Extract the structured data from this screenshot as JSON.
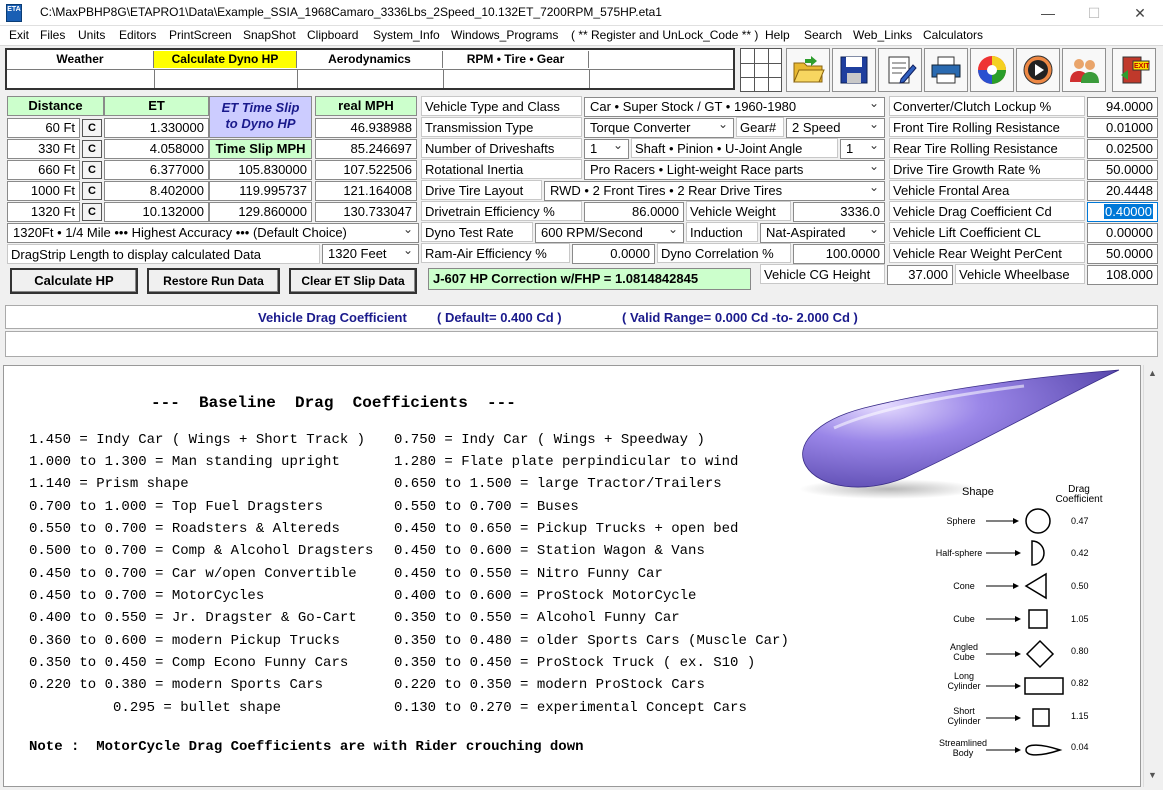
{
  "window": {
    "title": "C:\\MaxPBHP8G\\ETAPRO1\\Data\\Example_SSIA_1968Camaro_3336Lbs_2Speed_10.132ET_7200RPM_575HP.eta1",
    "icon_text": "ETA",
    "minimize": "—",
    "maximize": "☐",
    "close": "✕"
  },
  "menu": [
    "Exit",
    "Files",
    "Units",
    "Editors",
    "PrintScreen",
    "SnapShot",
    "Clipboard",
    "System_Info",
    "Windows_Programs",
    "( ** Register and UnLock_Code ** )",
    "Help",
    "Search",
    "Web_Links",
    "Calculators"
  ],
  "tabs": [
    "Weather",
    "Calculate Dyno HP",
    "Aerodynamics",
    "RPM  •  Tire  •  Gear"
  ],
  "toolbar": [
    "open-folder-icon",
    "save-disk-icon",
    "edit-notepad-icon",
    "printer-icon",
    "color-wheel-icon",
    "play-icon",
    "users-icon",
    "exit-door-icon"
  ],
  "colors": {
    "yellow_tab": "#ffff00",
    "green_header": "#ccffcc",
    "title_blue": "#1a1a8c",
    "selection": "#0078d7"
  },
  "runs": {
    "headers": {
      "distance": "Distance",
      "et": "ET",
      "et_slip": "ET Time Slip to Dyno HP",
      "time_slip_mph": "Time Slip MPH",
      "real_mph": "real  MPH"
    },
    "clear_label": "C",
    "rows": [
      {
        "dist": "60 Ft",
        "et": "1.330000",
        "slip_mph": "",
        "real_mph": "46.938988"
      },
      {
        "dist": "330 Ft",
        "et": "4.058000",
        "slip_mph": "",
        "real_mph": "85.246697"
      },
      {
        "dist": "660 Ft",
        "et": "6.377000",
        "slip_mph": "105.830000",
        "real_mph": "107.522506"
      },
      {
        "dist": "1000 Ft",
        "et": "8.402000",
        "slip_mph": "119.995737",
        "real_mph": "121.164008"
      },
      {
        "dist": "1320 Ft",
        "et": "10.132000",
        "slip_mph": "129.860000",
        "real_mph": "130.733047"
      }
    ],
    "accuracy": "1320Ft • 1/4 Mile ••• Highest Accuracy ••• (Default Choice)",
    "dragstrip_label": "DragStrip Length to display calculated Data",
    "dragstrip_value": "1320 Feet",
    "calc_btn": "Calculate  HP",
    "restore_btn": "Restore Run Data",
    "clear_btn": "Clear ET Slip Data",
    "correction": "J-607 HP Correction w/FHP = 1.0814842845"
  },
  "vehicle": {
    "type_label": "Vehicle Type and Class",
    "type_value": "Car  •  Super Stock / GT  •  1960-1980",
    "trans_label": "Transmission Type",
    "trans_value": "Torque Converter",
    "gear_label": "Gear#",
    "gear_value": "2  Speed",
    "shafts_label": "Number of Driveshafts",
    "shafts_value": "1",
    "ujoint_label": "Shaft • Pinion • U-Joint Angle",
    "ujoint_value": "1",
    "inertia_label": "Rotational Inertia",
    "inertia_value": "Pro Racers  •  Light-weight Race parts",
    "layout_label": "Drive Tire Layout",
    "layout_value": "RWD • 2  Front Tires  •  2  Rear Drive Tires",
    "eff_label": "Drivetrain Efficiency %",
    "eff_value": "86.0000",
    "weight_label": "Vehicle Weight",
    "weight_value": "3336.0",
    "dyno_label": "Dyno Test Rate",
    "dyno_value": "600 RPM/Second",
    "induction_label": "Induction",
    "induction_value": "Nat-Aspirated",
    "ram_label": "Ram-Air Efficiency %",
    "ram_value": "0.0000",
    "corr_label": "Dyno Correlation %",
    "corr_value": "100.0000",
    "cg_label": "Vehicle CG Height",
    "cg_value": "37.000",
    "wb_label": "Vehicle Wheelbase",
    "wb_value": "108.000"
  },
  "aero": {
    "lockup_label": "Converter/Clutch Lockup %",
    "lockup_value": "94.0000",
    "front_rr_label": "Front Tire Rolling Resistance",
    "front_rr_value": "0.01000",
    "rear_rr_label": "Rear Tire Rolling Resistance",
    "rear_rr_value": "0.02500",
    "growth_label": "Drive Tire Growth Rate %",
    "growth_value": "50.0000",
    "area_label": "Vehicle Frontal Area",
    "area_value": "20.4448",
    "cd_label": "Vehicle Drag Coefficient  Cd",
    "cd_value": "0.40000",
    "cl_label": "Vehicle Lift Coefficient   CL",
    "cl_value": "0.00000",
    "rear_w_label": "Vehicle Rear Weight PerCent",
    "rear_w_value": "50.0000"
  },
  "info": {
    "field": "Vehicle Drag Coefficient",
    "default": "( Default= 0.400 Cd )",
    "range": "( Valid Range=  0.000 Cd  -to-  2.000 Cd  )"
  },
  "table": {
    "title": "---  Baseline  Drag  Coefficients  ---",
    "left": [
      "1.450 = Indy Car ( Wings + Short Track )",
      "1.000 to 1.300 = Man standing upright",
      "1.140 = Prism shape",
      "0.700 to 1.000 = Top Fuel Dragsters",
      "0.550 to 0.700 = Roadsters & Altereds",
      "0.500 to 0.700 = Comp & Alcohol Dragsters",
      "0.450 to 0.700 = Car w/open Convertible",
      "0.450 to 0.700 = MotorCycles",
      "0.400 to 0.550 = Jr. Dragster & Go-Cart",
      "0.360 to 0.600 = modern Pickup Trucks",
      "0.350 to 0.450 = Comp Econo Funny Cars",
      "0.220 to 0.380 = modern Sports Cars",
      "          0.295 = bullet shape"
    ],
    "right": [
      "0.750 = Indy Car ( Wings + Speedway )",
      "1.280 = Flate plate perpindicular to wind",
      "0.650 to 1.500 = large Tractor/Trailers",
      "0.550 to 0.700 = Buses",
      "0.450 to 0.650 = Pickup Trucks + open bed",
      "0.450 to 0.600 = Station Wagon & Vans",
      "0.450 to 0.550 = Nitro Funny Car",
      "0.400 to 0.600 = ProStock MotorCycle",
      "0.350 to 0.550 = Alcohol Funny Car",
      "0.350 to 0.480 = older Sports Cars (Muscle Car)",
      "0.350 to 0.450 = ProStock Truck ( ex. S10 )",
      "0.220 to 0.350 = modern ProStock Cars",
      "0.130 to 0.270 = experimental Concept Cars"
    ],
    "note": "Note :  MotorCycle Drag Coefficients are with Rider crouching down"
  },
  "shapes": {
    "header_shape": "Shape",
    "header_drag": "Drag Coefficient",
    "items": [
      {
        "name": "Sphere",
        "cd": "0.47"
      },
      {
        "name": "Half-sphere",
        "cd": "0.42"
      },
      {
        "name": "Cone",
        "cd": "0.50"
      },
      {
        "name": "Cube",
        "cd": "1.05"
      },
      {
        "name": "Angled Cube",
        "cd": "0.80"
      },
      {
        "name": "Long Cylinder",
        "cd": "0.82"
      },
      {
        "name": "Short Cylinder",
        "cd": "1.15"
      },
      {
        "name": "Streamlined Body",
        "cd": "0.04"
      }
    ]
  },
  "scroll": {
    "up": "▲",
    "down": "▼"
  }
}
